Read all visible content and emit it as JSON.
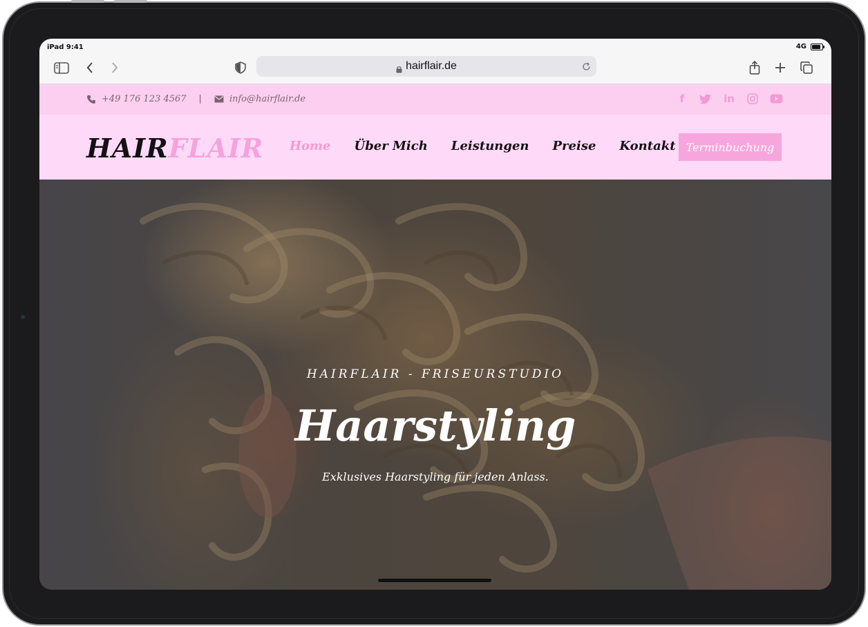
{
  "status": {
    "time": "iPad 9:41",
    "network": "4G"
  },
  "browser": {
    "url": "hairflair.de"
  },
  "contact": {
    "phone": "+49 176 123 4567",
    "separator": "|",
    "email": "info@hairflair.de"
  },
  "socials": [
    "facebook-icon",
    "twitter-icon",
    "linkedin-icon",
    "instagram-icon",
    "youtube-icon"
  ],
  "logo": {
    "part1": "HAIR",
    "part2": "FLAIR"
  },
  "nav": {
    "items": [
      {
        "label": "Home"
      },
      {
        "label": "Über Mich"
      },
      {
        "label": "Leistungen"
      },
      {
        "label": "Preise"
      },
      {
        "label": "Kontakt"
      }
    ],
    "active_index": 0,
    "cta": "Terminbuchung"
  },
  "hero": {
    "kicker": "HAIRFLAIR - FRISEURSTUDIO",
    "headline": "Haarstyling",
    "tagline": "Exklusives Haarstyling für jeden Anlass."
  },
  "colors": {
    "accent_pink": "#f29ad5",
    "topbar_bg": "#fccff0",
    "nav_bg": "#fedaf8",
    "cta_bg": "#f7a6dd"
  }
}
